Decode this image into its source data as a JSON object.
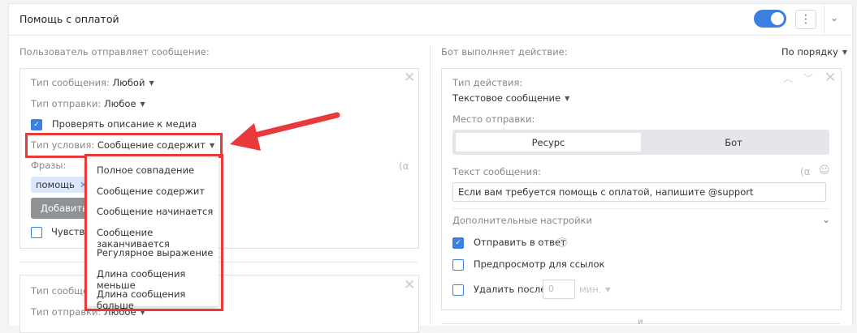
{
  "header": {
    "title": "Помощь с оплатой",
    "toggle_on": true,
    "more_icon": "kebab-vertical-icon",
    "collapse_icon": "chevron-down-icon"
  },
  "left": {
    "section_label": "Пользователь отправляет сообщение:",
    "card1": {
      "msg_type_label": "Тип сообщения:",
      "msg_type_value": "Любой",
      "send_type_label": "Тип отправки:",
      "send_type_value": "Любое",
      "check_media_label": "Проверять описание к медиа",
      "check_media_checked": true,
      "condition_label": "Тип условия:",
      "condition_value": "Сообщение содержит",
      "phrases_label": "Фразы:",
      "phrase_tag": "помощь",
      "add_button": "Добавить",
      "sensitive_label": "Чувстви"
    },
    "card2": {
      "msg_type_label": "Тип сообщен",
      "send_type_label": "Тип отправки:",
      "send_type_value": "Любое"
    }
  },
  "dropdown": {
    "items": [
      "Полное совпадение",
      "Сообщение содержит",
      "Сообщение начинается",
      "Сообщение заканчивается",
      "Регулярное выражение",
      "Длина сообщения меньше",
      "Длина сообщения больше"
    ]
  },
  "right": {
    "section_label": "Бот выполняет действие:",
    "order_value": "По порядку",
    "action_type_label": "Тип действия:",
    "action_type_value": "Текстовое сообщение",
    "send_place_label": "Место отправки:",
    "seg_resource": "Ресурс",
    "seg_bot": "Бот",
    "msg_text_label": "Текст сообщения:",
    "msg_text_value": "Если вам требуется помощь с оплатой, напишите @support",
    "extra_settings_label": "Дополнительные настройки",
    "reply_label": "Отправить в ответ",
    "reply_checked": true,
    "preview_label": "Предпросмотр для ссылок",
    "preview_checked": false,
    "delete_label": "Удалить после:",
    "delete_value": "0",
    "delete_unit": "мин."
  },
  "between_marker": "и",
  "colors": {
    "accent": "#3d7fe0",
    "highlight": "#e83a3a",
    "tag_bg": "#dbe8fb"
  }
}
